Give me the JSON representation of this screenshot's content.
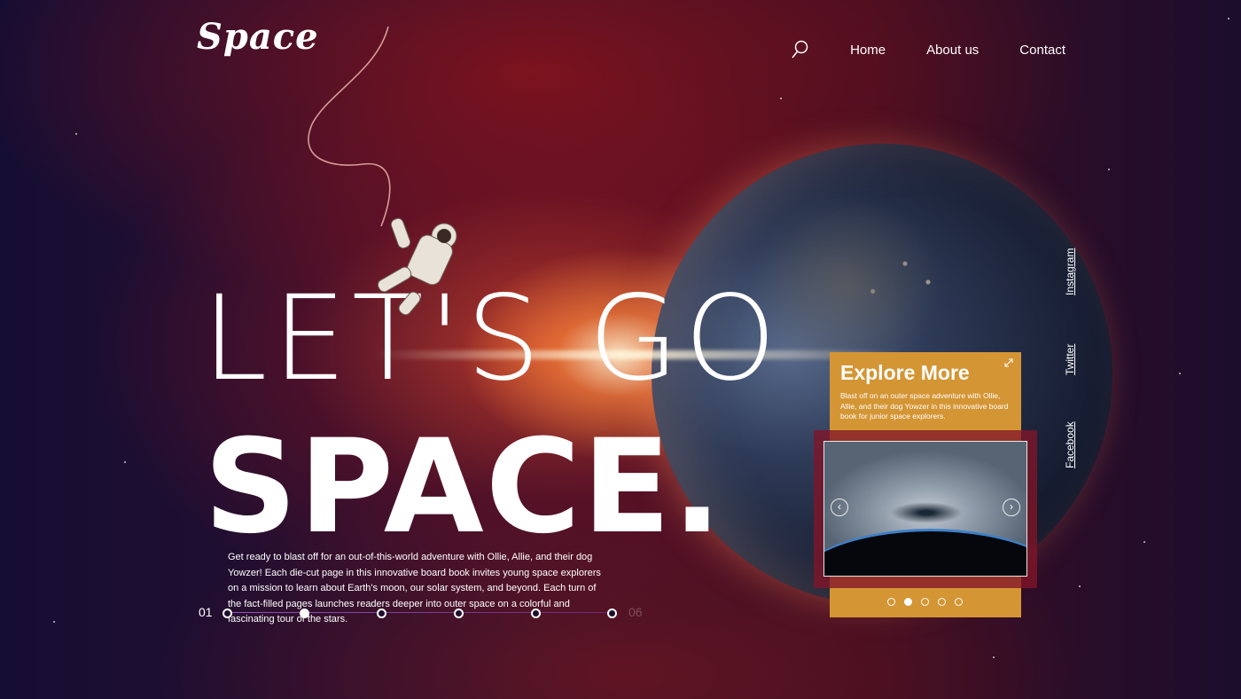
{
  "logo": {
    "text": "Space"
  },
  "nav": {
    "items": [
      {
        "label": "Home"
      },
      {
        "label": "About us"
      },
      {
        "label": "Contact"
      }
    ]
  },
  "hero": {
    "line1": "LET'S GO",
    "line2": "SPACE.",
    "description": "Get ready to blast off for an out-of-this-world adventure with Ollie, Allie, and their dog Yowzer! Each die-cut page in this innovative board book invites young space explorers on a mission to learn about Earth's moon, our solar system, and beyond. Each turn of the fact-filled pages launches readers deeper into outer space on a colorful and fascinating tour of the stars."
  },
  "pager": {
    "start": "01",
    "end": "06",
    "total_dots": 6,
    "active_index": 1
  },
  "social": {
    "items": [
      {
        "label": "Instagram"
      },
      {
        "label": "Twitter"
      },
      {
        "label": "Facebook"
      }
    ]
  },
  "explore": {
    "title": "Explore More",
    "description": "Blast off on an outer space adventure with Ollie, Allie, and their dog Yowzer in this innovative board book for junior space explorers.",
    "slide_count": 5,
    "active_slide": 1
  },
  "colors": {
    "accent": "#d49534",
    "frame": "#82142a",
    "text": "#ffffff"
  }
}
